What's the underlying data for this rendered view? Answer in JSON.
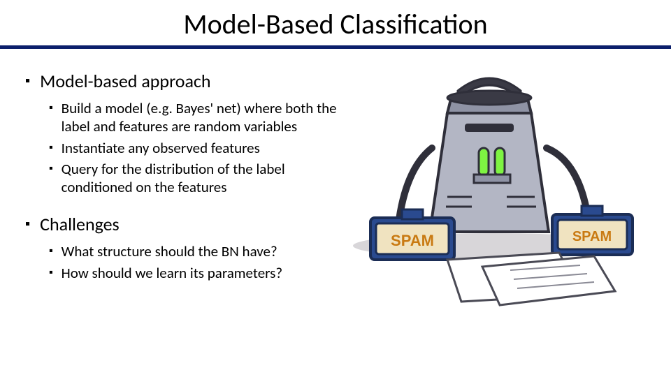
{
  "title": "Model-Based Classification",
  "sections": [
    {
      "heading": "Model-based approach",
      "items": [
        "Build a model (e.g. Bayes' net) where both the label and features are random variables",
        "Instantiate any observed features",
        "Query for the distribution of the label conditioned on the features"
      ]
    },
    {
      "heading": "Challenges",
      "items": [
        "What structure should the BN have?",
        "How should we learn its parameters?"
      ]
    }
  ],
  "illustration": {
    "label_left": "SPAM",
    "label_right": "SPAM"
  }
}
